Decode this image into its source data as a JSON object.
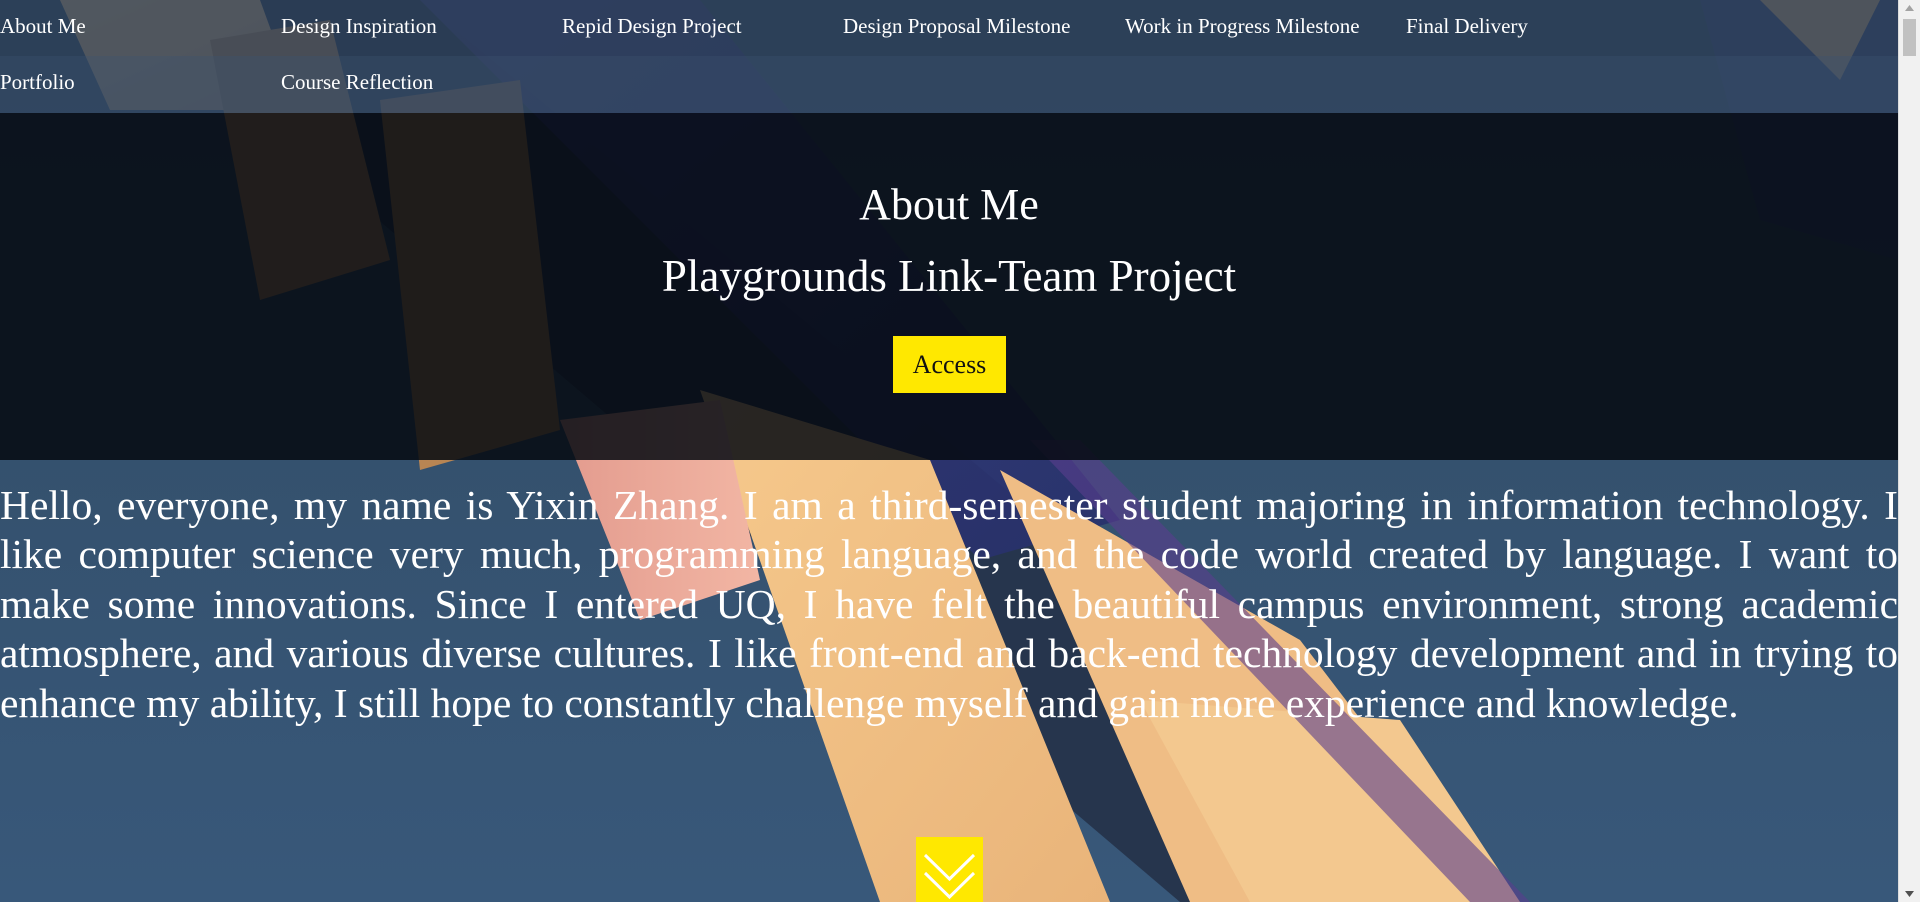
{
  "nav": {
    "items": [
      {
        "label": "About Me"
      },
      {
        "label": "Design Inspiration"
      },
      {
        "label": "Repid Design Project"
      },
      {
        "label": "Design Proposal Milestone"
      },
      {
        "label": "Work in Progress Milestone"
      },
      {
        "label": "Final Delivery"
      },
      {
        "label": "Portfolio"
      },
      {
        "label": "Course Reflection"
      }
    ]
  },
  "hero": {
    "title": "About Me",
    "subtitle": "Playgrounds Link-Team Project",
    "button_label": "Access"
  },
  "intro": {
    "text": "Hello, everyone, my name is Yixin Zhang. I am a third-semester student majoring in information technology. I like computer science very much, programming language, and the code world created by language. I want to make some innovations. Since I entered UQ, I have felt the beautiful campus environment, strong academic atmosphere, and various diverse cultures. I like front-end and back-end technology development and in trying to enhance my ability, I still hope to constantly challenge myself and gain more experience and knowledge."
  },
  "scroll_down": {
    "icon": "double-chevron-down-icon"
  },
  "colors": {
    "accent": "#ffe800",
    "hero_overlay": "#060a12",
    "nav_bg": "#2c3e56"
  }
}
